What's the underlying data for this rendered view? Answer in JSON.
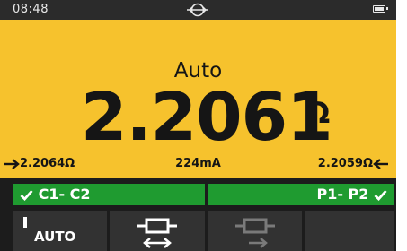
{
  "status_bar": {
    "time": "08:48",
    "center_icon": "probe-link-icon",
    "battery_icon": "battery-icon"
  },
  "measurement": {
    "mode": "Auto",
    "value": "2.2061",
    "unit": "Ω",
    "left_reading": "2.2064Ω",
    "current": "224mA",
    "right_reading": "2.2059Ω"
  },
  "probes": {
    "left_label": "C1- C2",
    "right_label": "P1- P2",
    "status_color": "#1f9b30"
  },
  "softkeys": {
    "key1_label": "AUTO",
    "key2_icon": "bidirectional-resistor-icon",
    "key3_icon": "forward-resistor-icon",
    "key4_label": ""
  },
  "colors": {
    "display_background": "#f6c22d",
    "frame": "#1c1c1c",
    "softkey": "#323232"
  }
}
